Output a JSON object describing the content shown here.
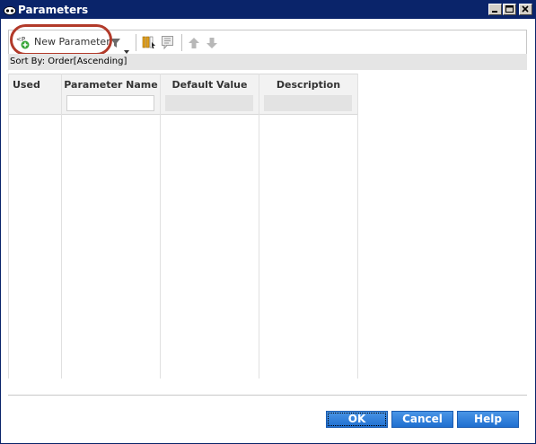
{
  "window": {
    "title": "Parameters"
  },
  "toolbar": {
    "new_parameter_label": "New Parameter"
  },
  "sort": {
    "text": "Sort By: Order[Ascending]"
  },
  "grid": {
    "columns": [
      "Used",
      "Parameter Name",
      "Default Value",
      "Description"
    ]
  },
  "buttons": {
    "ok": "OK",
    "cancel": "Cancel",
    "help": "Help"
  },
  "colors": {
    "titlebar": "#0a246a",
    "button": "#1f6fd0",
    "highlight": "#b23a2a"
  },
  "icons": [
    "app-icon",
    "minimize-icon",
    "maximize-icon",
    "close-icon",
    "new-parameter-icon",
    "filter-icon",
    "dropdown-arrow-icon",
    "select-columns-icon",
    "comment-icon",
    "move-up-icon",
    "move-down-icon"
  ]
}
